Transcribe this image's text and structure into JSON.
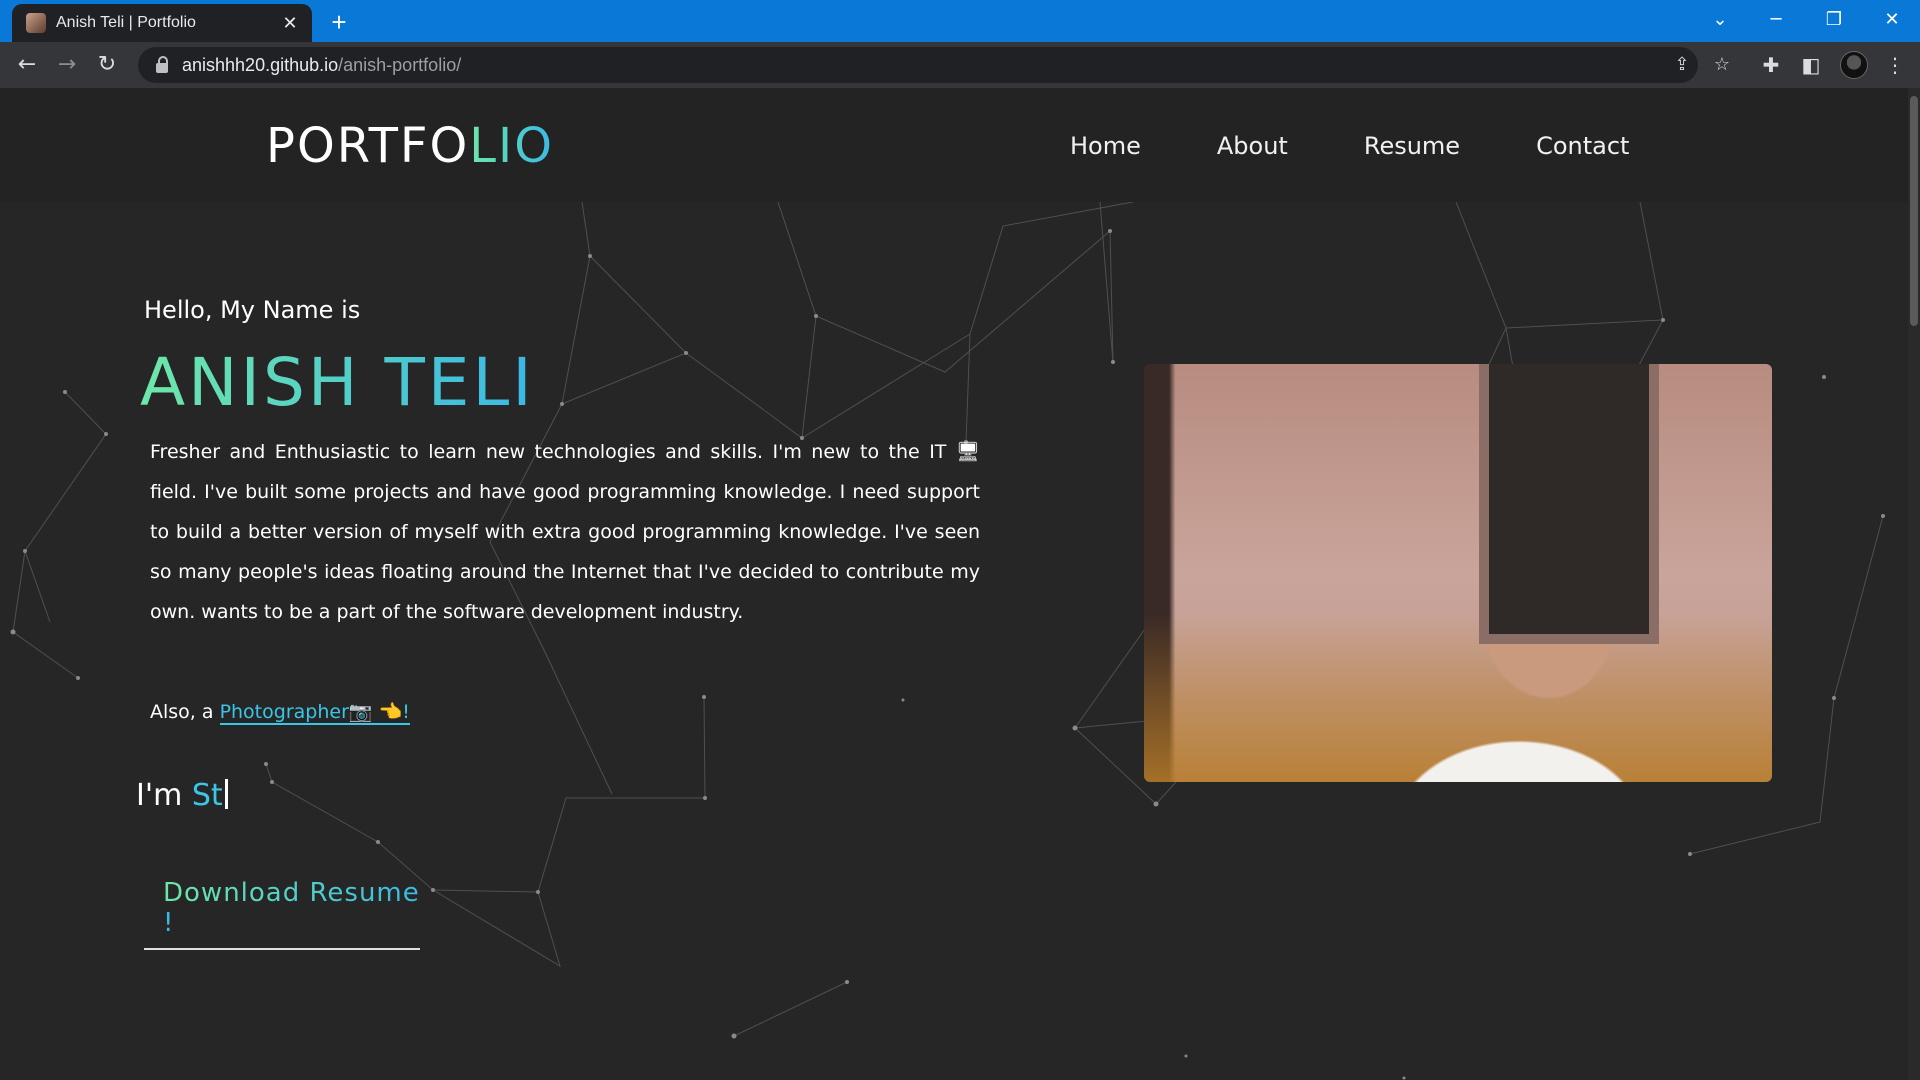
{
  "browser": {
    "tab_title": "Anish Teli | Portfolio",
    "new_tab_label": "+",
    "url_host": "anishhh20.github.io",
    "url_path": "/anish-portfolio/",
    "icons": [
      "back-icon",
      "forward-icon",
      "reload-icon",
      "lock-icon",
      "share-icon",
      "star-icon",
      "extensions-icon",
      "sidepanel-icon",
      "profile-avatar",
      "menu-icon",
      "tab-search-icon",
      "minimize-icon",
      "restore-icon",
      "close-icon"
    ]
  },
  "site": {
    "logo_main": "PORTFO",
    "logo_accent": "LIO",
    "nav": [
      "Home",
      "About",
      "Resume",
      "Contact"
    ],
    "greeting": "Hello, My Name is",
    "name": "ANISH TELI",
    "bio": "Fresher and Enthusiastic to learn new technologies and skills. I'm new to the IT 🖥 field. I've built some projects and have good programming knowledge. I need support to build a better version of myself with extra good programming knowledge. I've seen so many people's ideas floating around the Internet that I've decided to contribute my own. wants to be a part of the software development industry.",
    "also_prefix": "Also, a ",
    "also_link": "Photographer📷 👈!",
    "typed_prefix": "I'm ",
    "typed_text": "St",
    "download_label": "Download Resume !"
  },
  "colors": {
    "accent_gradient_start": "#6ee7a8",
    "accent_gradient_end": "#3ab7e6",
    "link": "#3bc6e8",
    "background": "#262626",
    "tabstrip": "#0a78d7"
  }
}
